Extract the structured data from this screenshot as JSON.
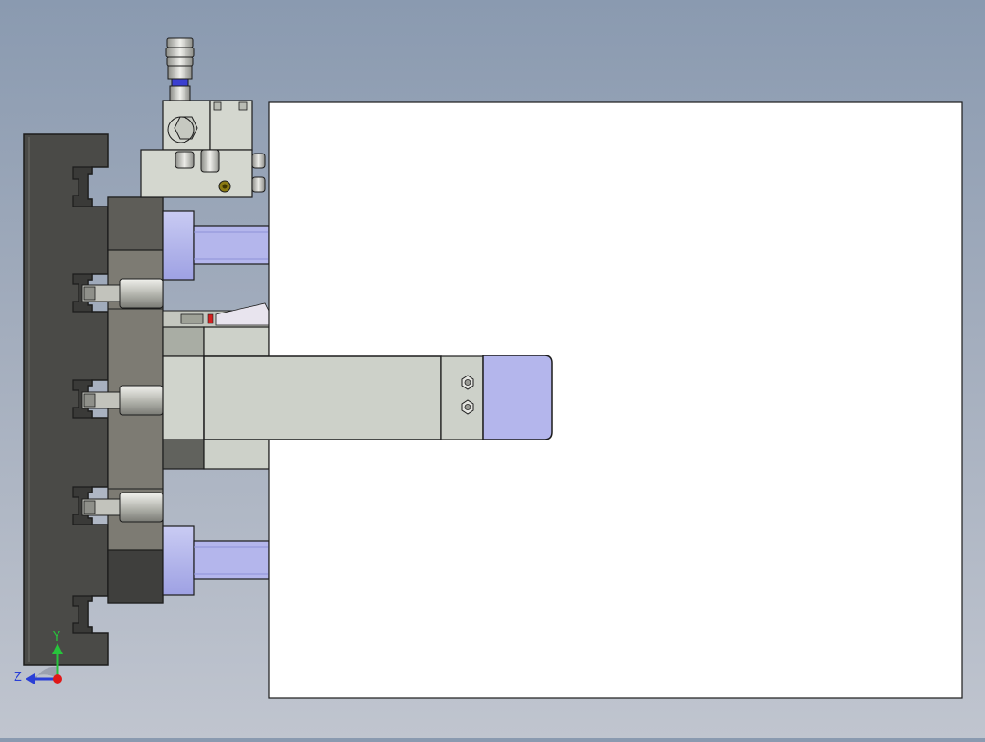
{
  "viewport": {
    "background_top": "#8a9ab0",
    "background_bottom": "#c0c5cf"
  },
  "model": {
    "colors": {
      "base_plate": "#4a4a47",
      "mount_block": "#7d7b73",
      "mount_block_dark": "#525250",
      "body_light": "#cdd1c9",
      "body_mid": "#a9ada4",
      "guide_accent": "#b4b6ec",
      "panel": "#ffffff",
      "outline": "#1c1c1c"
    }
  },
  "triad": {
    "y_label": "Y",
    "z_label": "Z",
    "y_color": "#27c43c",
    "z_color": "#2a3fd6",
    "x_color": "#e01818"
  }
}
